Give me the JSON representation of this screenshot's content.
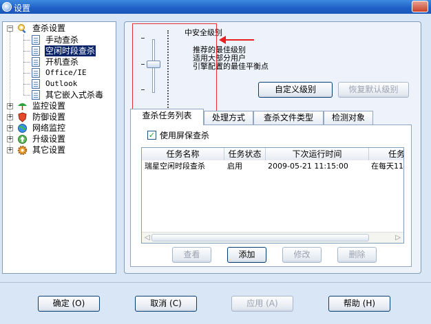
{
  "window": {
    "title": "设置"
  },
  "tree": {
    "root": "查杀设置",
    "children": [
      "手动查杀",
      "空闲时段查杀",
      "开机查杀",
      "Office/IE",
      "Outlook",
      "其它嵌入式杀毒"
    ],
    "selected": "空闲时段查杀",
    "others": [
      "监控设置",
      "防御设置",
      "网络监控",
      "升级设置",
      "其它设置"
    ]
  },
  "level": {
    "current": "中安全级别",
    "lines": [
      "推荐的最佳级别",
      "适用大部分用户",
      "引擎配置的最佳平衡点"
    ],
    "custom_button": "自定义级别",
    "reset_button": "恢复默认级别"
  },
  "tabs": [
    "查杀任务列表",
    "处理方式",
    "查杀文件类型",
    "检测对象"
  ],
  "active_tab": "查杀任务列表",
  "task_panel": {
    "checkbox_label": "使用屏保查杀",
    "checkbox_checked": true,
    "columns": [
      "任务名称",
      "任务状态",
      "下次运行时间",
      "任务"
    ],
    "rows": [
      {
        "name": "瑞星空闲时段查杀",
        "status": "启用",
        "next_run": "2009-05-21 11:15:00",
        "period": "在每天11"
      }
    ],
    "buttons": {
      "view": "查看",
      "add": "添加",
      "edit": "修改",
      "delete": "删除"
    }
  },
  "footer": {
    "ok": "确定 (O)",
    "cancel": "取消 (C)",
    "apply": "应用 (A)",
    "help": "帮助 (H)"
  },
  "colors": {
    "titlebar": "#1f5fc7",
    "selection": "#0a246a",
    "annotation": "#e03030"
  }
}
